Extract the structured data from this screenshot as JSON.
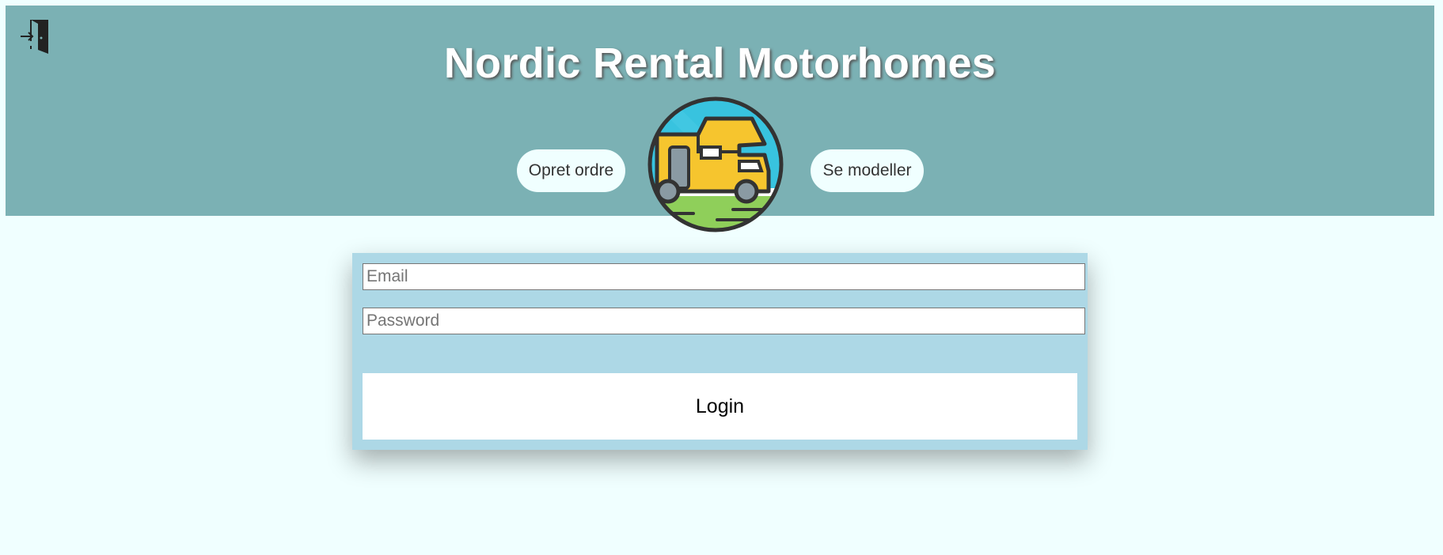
{
  "header": {
    "title": "Nordic Rental Motorhomes",
    "background": "#7bb1b4",
    "login_icon": "door-enter-icon",
    "logo": "motorhome-logo"
  },
  "nav": {
    "create_order_label": "Opret ordre",
    "see_models_label": "Se modeller"
  },
  "login_form": {
    "email_placeholder": "Email",
    "email_value": "",
    "password_placeholder": "Password",
    "password_value": "",
    "login_button_label": "Login",
    "panel_color": "#add8e6"
  },
  "page": {
    "background": "#f0ffff"
  }
}
